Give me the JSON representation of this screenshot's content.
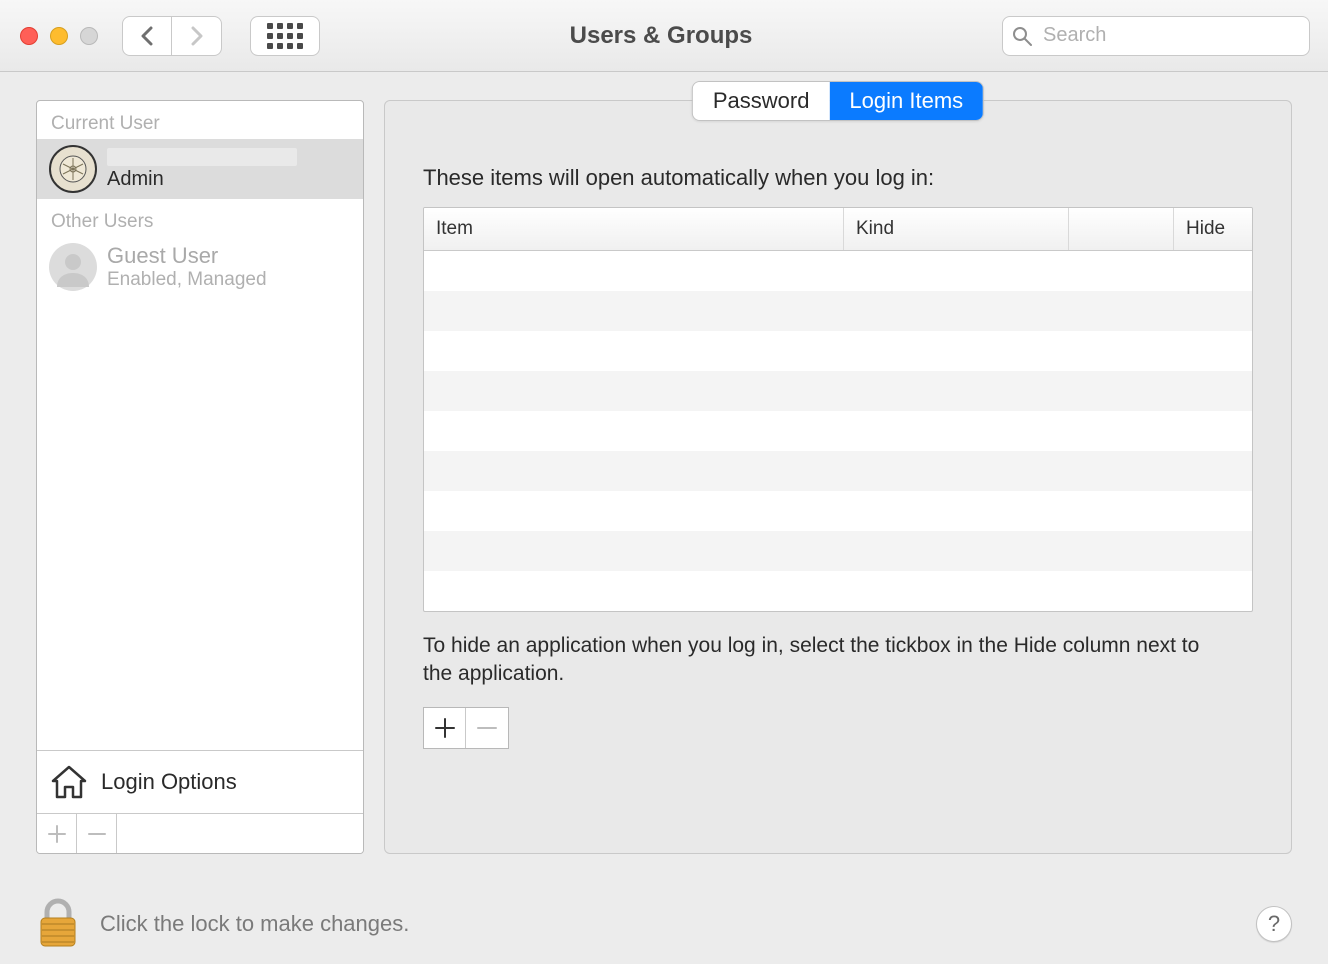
{
  "window": {
    "title": "Users & Groups"
  },
  "search": {
    "placeholder": "Search"
  },
  "sidebar": {
    "current_user_header": "Current User",
    "other_users_header": "Other Users",
    "current_user": {
      "name": "",
      "role": "Admin"
    },
    "other_users": [
      {
        "name": "Guest User",
        "sub": "Enabled, Managed"
      }
    ],
    "login_options_label": "Login Options"
  },
  "tabs": {
    "password": "Password",
    "login_items": "Login Items",
    "active": "login_items"
  },
  "main": {
    "intro": "These items will open automatically when you log in:",
    "columns": {
      "item": "Item",
      "kind": "Kind",
      "hide": "Hide"
    },
    "rows": [],
    "hint": "To hide an application when you log in, select the tickbox in the Hide column next to the application."
  },
  "footer": {
    "lock_text": "Click the lock to make changes."
  }
}
